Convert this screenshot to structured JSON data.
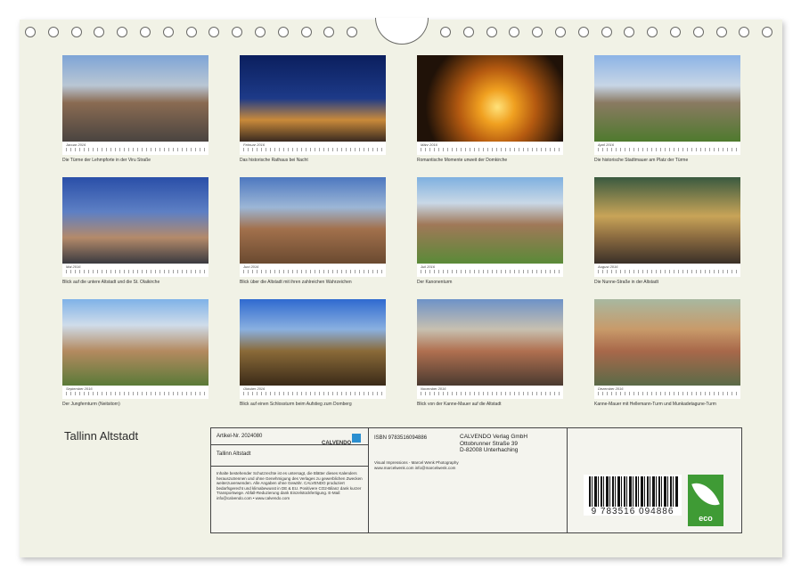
{
  "months": [
    {
      "month": "Januar 2016",
      "caption": "Die Türme der Lehmpforte in der Viru Straße"
    },
    {
      "month": "Februar 2016",
      "caption": "Das historische Rathaus bei Nacht"
    },
    {
      "month": "März 2016",
      "caption": "Romantische Momente unweit der Domkirche"
    },
    {
      "month": "April 2016",
      "caption": "Die historische Stadtmauer am Platz der Türme"
    },
    {
      "month": "Mai 2016",
      "caption": "Blick auf die untere Altstadt und die St. Olaikirche"
    },
    {
      "month": "Juni 2016",
      "caption": "Blick über die Altstadt mit ihren zahlreichen Wahrzeichen"
    },
    {
      "month": "Juli 2016",
      "caption": "Der Kanonenturm"
    },
    {
      "month": "August 2016",
      "caption": "Die Nunne-Straße in der Altstadt"
    },
    {
      "month": "September 2016",
      "caption": "Der Jungfernturm (Neitsitorn)"
    },
    {
      "month": "Oktober 2016",
      "caption": "Blick auf einen Schlossturm beim Aufstieg zum Domberg"
    },
    {
      "month": "November 2016",
      "caption": "Blick von der Kanne-Mauer auf die Altstadt"
    },
    {
      "month": "Dezember 2016",
      "caption": "Kanne-Mauer mit Hellemann-Turm und Munkadetagune-Turm"
    }
  ],
  "title": "Tallinn Altstadt",
  "info": {
    "artikel": "Artikel-Nr. 2024080",
    "logo": "CALVENDO",
    "product_title": "Tallinn Altstadt",
    "legal": "Inhalte bestehender Schutzrechte ist es untersagt, die Blätter dieses Kalenders herauszutrennen und ohne Genehmigung des Verlages zu gewerblichen Zwecken weiterzuverwenden. Alle Angaben ohne Gewähr. CALVENDO produziert bedarfsgerecht und klimabewusst in DE & EU. Positivere CO2-Bilanz dank kurzer Transportwege. Abfall-Reduzierung dank Einzelstückfertigung. E-Mail: info@calvendo.com • www.calvendo.com",
    "isbn": "ISBN 9783516094886",
    "publisher_1": "CALVENDO Verlag GmbH",
    "publisher_2": "Ottobrunner Straße 39",
    "publisher_3": "D-82008 Unterhaching",
    "credits": "Visual Impressions - Marcel Wenk Photography www.marcelwenk.com info@marcelwenk.com",
    "ean": "9 783516 094886",
    "eco": "eco"
  }
}
